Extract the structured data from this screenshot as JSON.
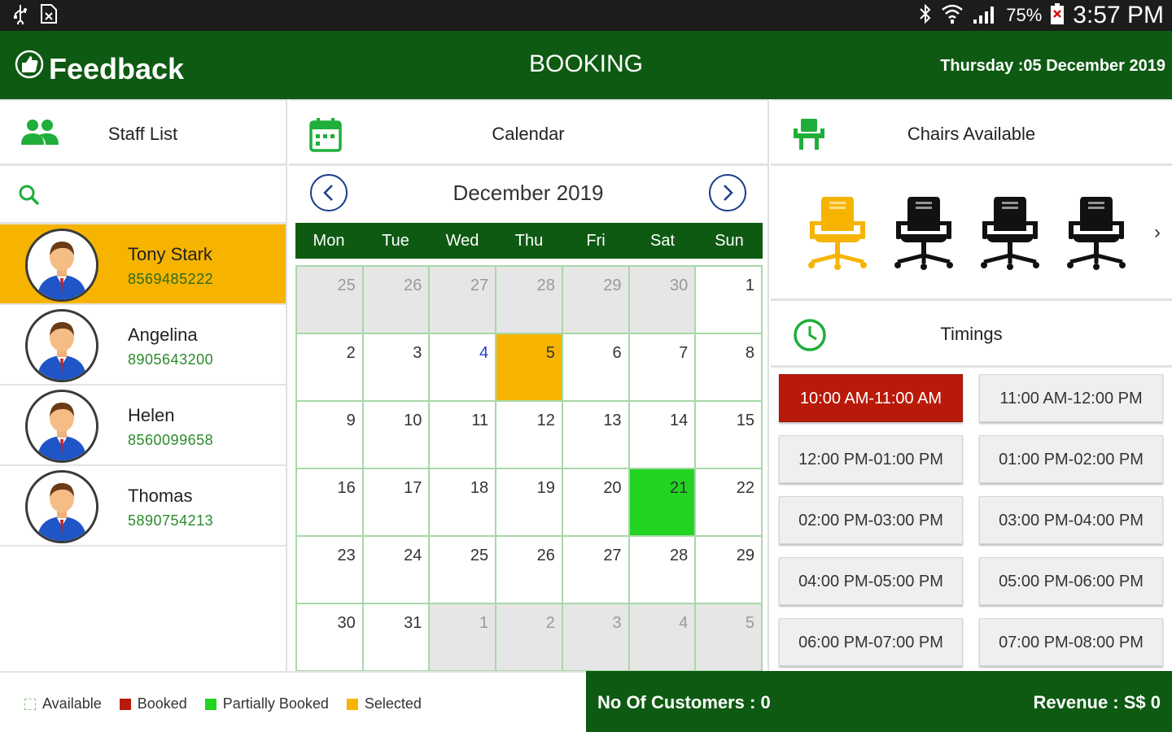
{
  "status_bar": {
    "battery": "75%",
    "time": "3:57 PM"
  },
  "app_bar": {
    "brand": "Feedback",
    "title": "BOOKING",
    "date": "Thursday :05 December 2019"
  },
  "staff_panel": {
    "header": "Staff List",
    "search_placeholder": "",
    "staff": [
      {
        "name": "Tony Stark",
        "phone": "8569485222",
        "selected": true
      },
      {
        "name": "Angelina",
        "phone": "8905643200",
        "selected": false
      },
      {
        "name": "Helen",
        "phone": "8560099658",
        "selected": false
      },
      {
        "name": "Thomas",
        "phone": "5890754213",
        "selected": false
      }
    ]
  },
  "calendar": {
    "header": "Calendar",
    "month_label": "December 2019",
    "weekdays": [
      "Mon",
      "Tue",
      "Wed",
      "Thu",
      "Fri",
      "Sat",
      "Sun"
    ],
    "days": [
      {
        "d": "25",
        "other": true
      },
      {
        "d": "26",
        "other": true
      },
      {
        "d": "27",
        "other": true
      },
      {
        "d": "28",
        "other": true
      },
      {
        "d": "29",
        "other": true
      },
      {
        "d": "30",
        "other": true
      },
      {
        "d": "1"
      },
      {
        "d": "2"
      },
      {
        "d": "3"
      },
      {
        "d": "4",
        "today": true
      },
      {
        "d": "5",
        "state": "selected"
      },
      {
        "d": "6"
      },
      {
        "d": "7"
      },
      {
        "d": "8"
      },
      {
        "d": "9"
      },
      {
        "d": "10"
      },
      {
        "d": "11"
      },
      {
        "d": "12"
      },
      {
        "d": "13"
      },
      {
        "d": "14"
      },
      {
        "d": "15"
      },
      {
        "d": "16"
      },
      {
        "d": "17"
      },
      {
        "d": "18"
      },
      {
        "d": "19"
      },
      {
        "d": "20"
      },
      {
        "d": "21",
        "state": "partial"
      },
      {
        "d": "22"
      },
      {
        "d": "23"
      },
      {
        "d": "24"
      },
      {
        "d": "25"
      },
      {
        "d": "26"
      },
      {
        "d": "27"
      },
      {
        "d": "28"
      },
      {
        "d": "29"
      },
      {
        "d": "30"
      },
      {
        "d": "31"
      },
      {
        "d": "1",
        "other": true
      },
      {
        "d": "2",
        "other": true
      },
      {
        "d": "3",
        "other": true
      },
      {
        "d": "4",
        "other": true
      },
      {
        "d": "5",
        "other": true
      }
    ]
  },
  "chairs_panel": {
    "header": "Chairs Available",
    "chairs": [
      {
        "name": "chair-1",
        "color": "#f6b400"
      },
      {
        "name": "chair-2",
        "color": "#111111"
      },
      {
        "name": "chair-3",
        "color": "#111111"
      },
      {
        "name": "chair-4",
        "color": "#111111"
      }
    ],
    "more_glyph": "›"
  },
  "timings_panel": {
    "header": "Timings",
    "slots": [
      {
        "label": "10:00 AM-11:00 AM",
        "booked": true
      },
      {
        "label": "11:00 AM-12:00 PM",
        "booked": false
      },
      {
        "label": "12:00 PM-01:00 PM",
        "booked": false
      },
      {
        "label": "01:00 PM-02:00 PM",
        "booked": false
      },
      {
        "label": "02:00 PM-03:00 PM",
        "booked": false
      },
      {
        "label": "03:00 PM-04:00 PM",
        "booked": false
      },
      {
        "label": "04:00 PM-05:00 PM",
        "booked": false
      },
      {
        "label": "05:00 PM-06:00 PM",
        "booked": false
      },
      {
        "label": "06:00 PM-07:00 PM",
        "booked": false
      },
      {
        "label": "07:00 PM-08:00 PM",
        "booked": false
      }
    ]
  },
  "legend": [
    {
      "label": "Available",
      "color": "#ffffff",
      "border": "#8cc98c"
    },
    {
      "label": "Booked",
      "color": "#b81a0a"
    },
    {
      "label": "Partially Booked",
      "color": "#22d422"
    },
    {
      "label": "Selected",
      "color": "#f6b400"
    }
  ],
  "footer": {
    "customers": "No Of Customers : 0",
    "revenue": "Revenue : S$ 0"
  },
  "colors": {
    "primary": "#0e5a12",
    "accent_green": "#1fae3a",
    "selected": "#f6b400",
    "booked": "#b81a0a",
    "partial": "#22d422"
  }
}
